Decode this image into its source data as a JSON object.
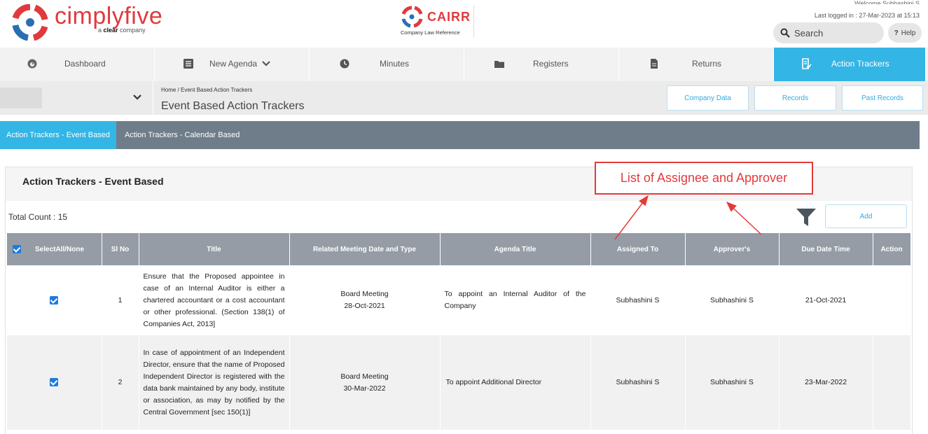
{
  "header": {
    "brand": "cimplyfive",
    "brand_tag_prefix": "a",
    "brand_tag_bold": "clear",
    "brand_tag_suffix": "company",
    "product": "CAIRR",
    "product_sub": "Company Law Reference",
    "welcome": "Welcome Subhashini S",
    "last_logged": "Last logged in : 27-Mar-2023 at 15:13",
    "search_placeholder": "Search",
    "help_label": "Help",
    "help_mark": "?"
  },
  "nav": [
    {
      "label": "Dashboard",
      "icon": "dashboard-icon"
    },
    {
      "label": "New Agenda",
      "icon": "agenda-icon"
    },
    {
      "label": "Minutes",
      "icon": "clock-icon"
    },
    {
      "label": "Registers",
      "icon": "folder-icon"
    },
    {
      "label": "Returns",
      "icon": "document-icon"
    },
    {
      "label": "Action Trackers",
      "icon": "tracker-icon",
      "active": true
    }
  ],
  "subheader": {
    "breadcrumb": "Home  /  Event Based Action Trackers",
    "title": "Event Based Action Trackers",
    "buttons": [
      "Company Data",
      "Records",
      "Past Records"
    ]
  },
  "tabs": [
    {
      "label": "Action Trackers - Event Based",
      "active": true
    },
    {
      "label": "Action Trackers - Calendar Based",
      "active": false
    }
  ],
  "panel": {
    "title": "Action Trackers - Event Based",
    "total_count": "Total Count : 15",
    "add_label": "Add"
  },
  "table": {
    "columns": [
      "SelectAll/None",
      "Sl No",
      "Title",
      "Related Meeting Date and Type",
      "Agenda Title",
      "Assigned To",
      "Approver's",
      "Due Date Time",
      "Action"
    ],
    "rows": [
      {
        "checked": true,
        "sl": "1",
        "title": "Ensure that the Proposed appointee in case of an Internal Auditor is either a chartered accountant or a cost accountant or other professional. (Section 138(1) of Companies Act, 2013]",
        "meeting_type": "Board Meeting",
        "meeting_date": "28-Oct-2021",
        "agenda": "To appoint an Internal Auditor of the Company",
        "assigned": "Subhashini S",
        "approver": "Subhashini S",
        "due": "21-Oct-2021",
        "action": ""
      },
      {
        "checked": true,
        "sl": "2",
        "title": "In case of appointment of an Independent Director, ensure that the name of Proposed Independent Director is registered with the data bank maintained by any body, institute or association, as may by notified by the Central Government [sec 150(1)]",
        "meeting_type": "Board Meeting",
        "meeting_date": "30-Mar-2022",
        "agenda": "To appoint Additional Director",
        "assigned": "Subhashini S",
        "approver": "Subhashini S",
        "due": "23-Mar-2022",
        "action": ""
      }
    ]
  },
  "annotation": {
    "text": "List of Assignee and Approver",
    "color": "#e53a3a"
  },
  "colors": {
    "accent": "#33b5e5",
    "brand_red": "#e03a3e",
    "tab_bar": "#6f7d8a",
    "table_header": "#959ca6"
  }
}
